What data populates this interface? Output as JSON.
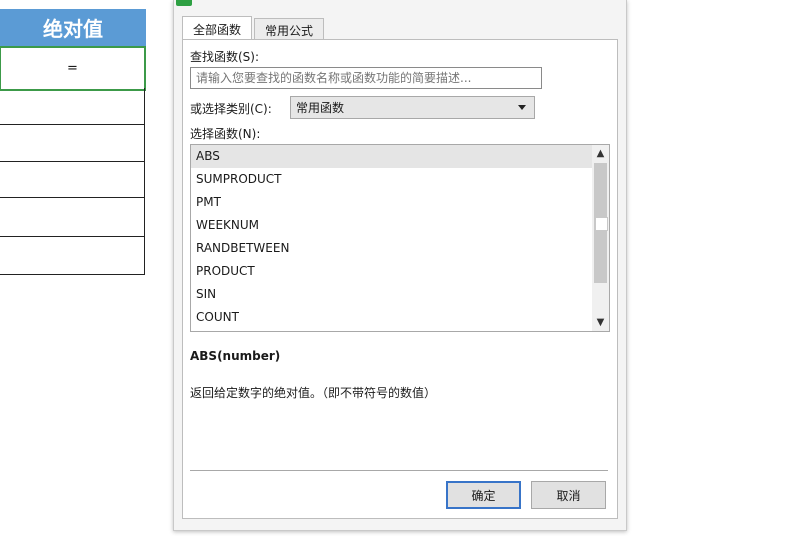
{
  "sheet": {
    "header": "绝对值",
    "active_cell": "="
  },
  "dialog": {
    "tabs": [
      {
        "label": "全部函数",
        "selected": true
      },
      {
        "label": "常用公式",
        "selected": false
      }
    ],
    "search": {
      "label": "查找函数(S):",
      "placeholder": "请输入您要查找的函数名称或函数功能的简要描述..."
    },
    "category": {
      "label": "或选择类别(C):",
      "value": "常用函数"
    },
    "function_list": {
      "label": "选择函数(N):",
      "items": [
        "ABS",
        "SUMPRODUCT",
        "PMT",
        "WEEKNUM",
        "RANDBETWEEN",
        "PRODUCT",
        "SIN",
        "COUNT"
      ],
      "selected_index": 0
    },
    "signature": "ABS(number)",
    "description": "返回给定数字的绝对值。（即不带符号的数值）",
    "buttons": {
      "ok": "确定",
      "cancel": "取消"
    },
    "colors": {
      "header_blue": "#5b9bd5",
      "active_cell_green": "#3c9a49",
      "ok_focus": "#3874c8"
    }
  }
}
